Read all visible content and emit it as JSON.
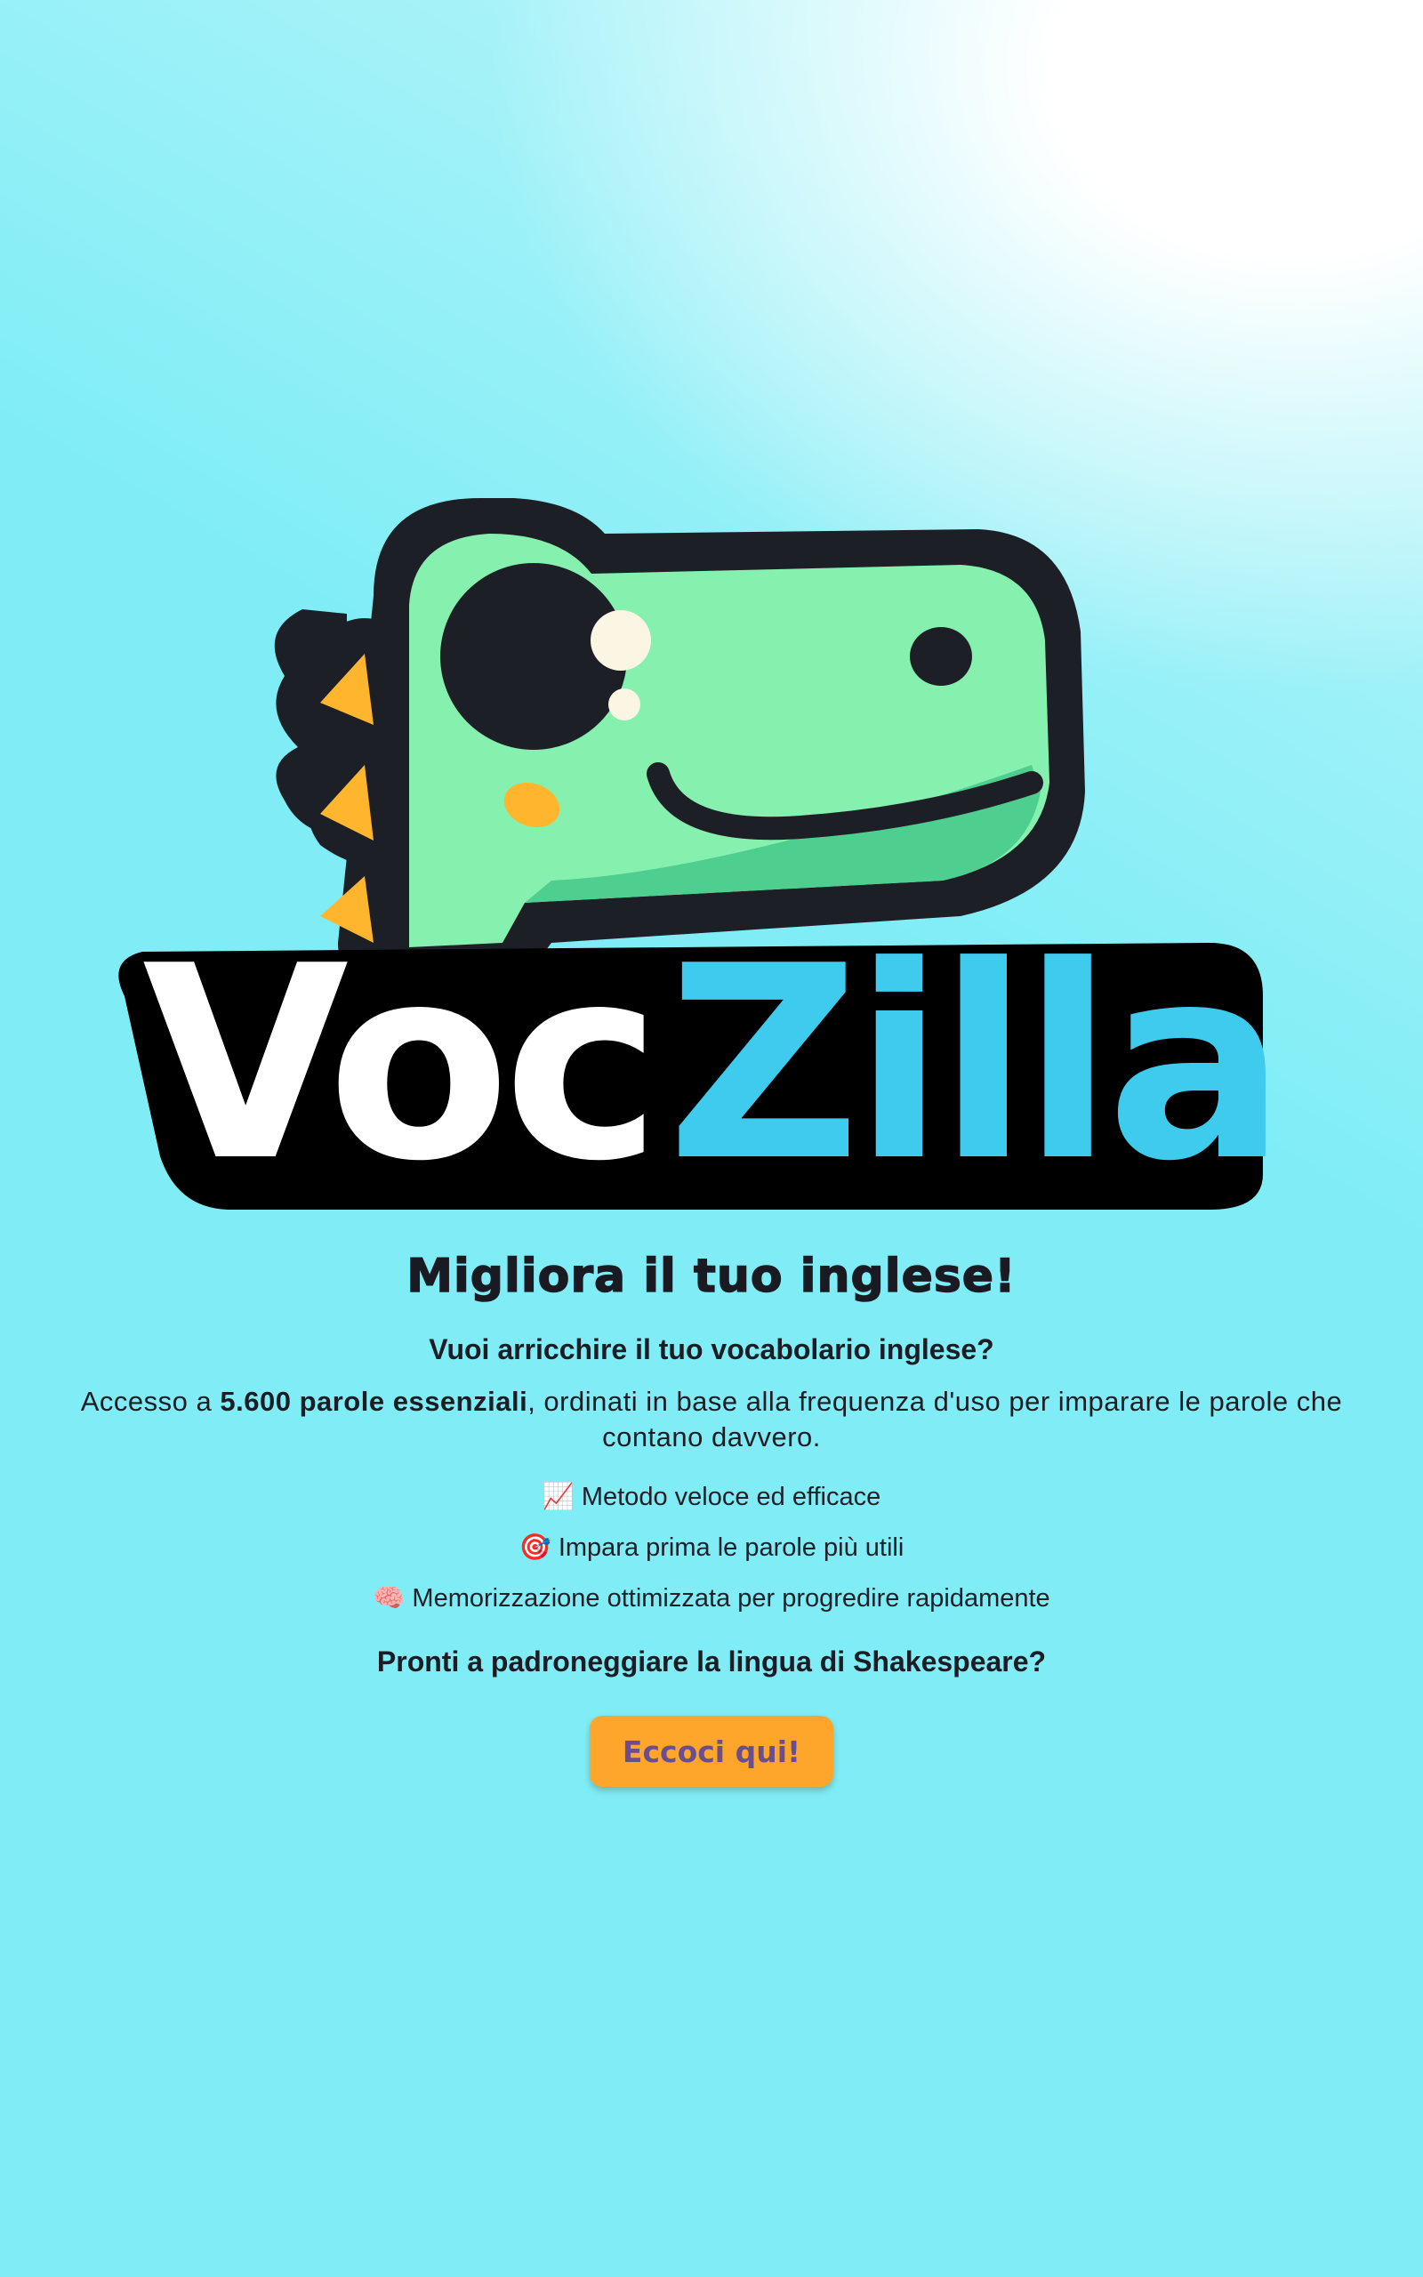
{
  "logo": {
    "brand_part1": "Voc",
    "brand_part2": "Zilla",
    "colors": {
      "dino_green": "#86f0ae",
      "outline": "#1d1f26",
      "spikes": "#ffb52e",
      "zilla_blue": "#3ecbee"
    }
  },
  "hero": {
    "headline": "Migliora il tuo inglese!",
    "subhead": "Vuoi arricchire il tuo vocabolario inglese?",
    "intro_prefix": "Accesso a ",
    "intro_bold": "5.600 parole essenziali",
    "intro_suffix": ", ordinati in base alla frequenza d'uso per imparare le parole che contano davvero."
  },
  "features": [
    {
      "icon": "chart-increasing-icon",
      "emoji": "📈",
      "text": "Metodo veloce ed efficace"
    },
    {
      "icon": "direct-hit-icon",
      "emoji": "🎯",
      "text": "Impara prima le parole più utili"
    },
    {
      "icon": "brain-icon",
      "emoji": "🧠",
      "text": "Memorizzazione ottimizzata per progredire rapidamente"
    }
  ],
  "cta": {
    "question": "Pronti a padroneggiare la lingua di Shakespeare?",
    "button_label": "Eccoci qui!"
  },
  "theme": {
    "background": "#80edf6",
    "button_bg": "#fea62b",
    "button_text": "#6a4e8e"
  }
}
